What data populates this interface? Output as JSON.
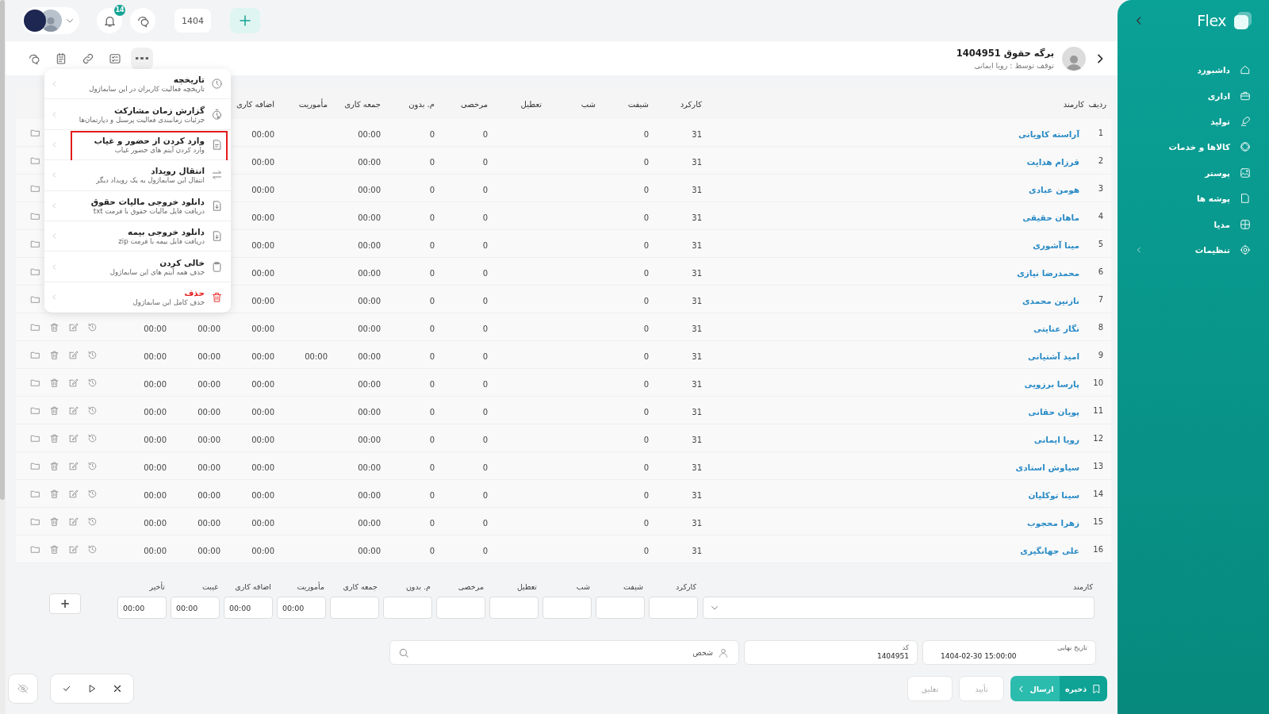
{
  "topbar": {
    "notification_count": "14",
    "year": "1404"
  },
  "header": {
    "title": "برگه حقوق 1404951",
    "subtitle": "توقف توسط : رویا ایمانی"
  },
  "toolbar": [
    {
      "kind": "chat",
      "selected": false
    },
    {
      "kind": "notes",
      "selected": false
    },
    {
      "kind": "link",
      "selected": false
    },
    {
      "kind": "checklist",
      "selected": false
    },
    {
      "kind": "more",
      "selected": true
    }
  ],
  "menu": {
    "items": [
      {
        "kind": "history",
        "title": "تاریخچه",
        "description": "تاریخچه فعالیت کاربران در این سابماژول",
        "highlighted": false
      },
      {
        "kind": "report",
        "title": "گزارش زمان مشارکت",
        "description": "جزئیات زمانبندی فعالیت پرسنل و دپارتمان‌ها",
        "highlighted": false
      },
      {
        "kind": "import",
        "title": "وارد کردن از حضور و غیاب",
        "description": "وارد کردن آیتم های حضور غیاب",
        "highlighted": true
      },
      {
        "kind": "transfer",
        "title": "انتقال رویداد",
        "description": "انتقال این سابماژول به یک رویداد دیگر",
        "highlighted": false
      },
      {
        "kind": "download",
        "title": "دانلود خروجی مالیات حقوق",
        "description": "دریافت فایل مالیات حقوق با فرمت txt",
        "highlighted": false
      },
      {
        "kind": "download",
        "title": "دانلود خروجی بیمه",
        "description": "دریافت فایل بیمه با فرمت zip",
        "highlighted": false
      },
      {
        "kind": "clear",
        "title": "خالی کردن",
        "description": "حذف همه آیتم های این سابماژول",
        "highlighted": false
      },
      {
        "kind": "delete",
        "title": "حذف",
        "description": "حذف کامل این سابماژول",
        "highlighted": false
      }
    ]
  },
  "table": {
    "columns": [
      "ردیف",
      "کارمند",
      "کارکرد",
      "شیفت",
      "شب",
      "تعطیل",
      "مرخصی",
      "م. بدون",
      "جمعه کاری",
      "مأموریت",
      "اضافه کاری"
    ],
    "rows": [
      {
        "number": "1",
        "name": "آراسته کاویانی",
        "worked": "31",
        "shift": "0",
        "leave": "0",
        "unpaid": "0",
        "friday": "00:00",
        "overtime": "00:00"
      },
      {
        "number": "2",
        "name": "فرزام هدایت",
        "worked": "31",
        "shift": "0",
        "leave": "0",
        "unpaid": "0",
        "friday": "00:00",
        "overtime": "00:00"
      },
      {
        "number": "3",
        "name": "هومن عبادی",
        "worked": "31",
        "shift": "0",
        "leave": "0",
        "unpaid": "0",
        "friday": "00:00",
        "overtime": "00:00"
      },
      {
        "number": "4",
        "name": "ماهان حقیقی",
        "worked": "31",
        "shift": "0",
        "leave": "0",
        "unpaid": "0",
        "friday": "00:00",
        "overtime": "00:00"
      },
      {
        "number": "5",
        "name": "مینا آشوری",
        "worked": "31",
        "shift": "0",
        "leave": "0",
        "unpaid": "0",
        "friday": "00:00",
        "overtime": "00:00"
      },
      {
        "number": "6",
        "name": "محمدرضا نیازی",
        "worked": "31",
        "shift": "0",
        "leave": "0",
        "unpaid": "0",
        "friday": "00:00",
        "overtime": "00:00"
      },
      {
        "number": "7",
        "name": "نازنین محمدی",
        "worked": "31",
        "shift": "0",
        "leave": "0",
        "unpaid": "0",
        "friday": "00:00",
        "overtime": "00:00"
      },
      {
        "number": "8",
        "name": "نگار عنایتی",
        "worked": "31",
        "shift": "0",
        "leave": "0",
        "unpaid": "0",
        "friday": "00:00",
        "overtime": "00:00",
        "absence": "00:00",
        "late": "00:00"
      },
      {
        "number": "9",
        "name": "امید آشتیانی",
        "worked": "31",
        "shift": "0",
        "leave": "0",
        "unpaid": "0",
        "friday": "00:00",
        "mission": "00:00",
        "overtime": "00:00",
        "absence": "00:00",
        "late": "00:00"
      },
      {
        "number": "10",
        "name": "پارسا برزویی",
        "worked": "31",
        "shift": "0",
        "leave": "0",
        "unpaid": "0",
        "friday": "00:00",
        "overtime": "00:00",
        "absence": "00:00",
        "late": "00:00"
      },
      {
        "number": "11",
        "name": "پویان حقانی",
        "worked": "31",
        "shift": "0",
        "leave": "0",
        "unpaid": "0",
        "friday": "00:00",
        "overtime": "00:00",
        "absence": "00:00",
        "late": "00:00"
      },
      {
        "number": "12",
        "name": "رویا ایمانی",
        "worked": "31",
        "shift": "0",
        "leave": "0",
        "unpaid": "0",
        "friday": "00:00",
        "overtime": "00:00",
        "absence": "00:00",
        "late": "00:00"
      },
      {
        "number": "13",
        "name": "سیاوش استادی",
        "worked": "31",
        "shift": "0",
        "leave": "0",
        "unpaid": "0",
        "friday": "00:00",
        "overtime": "00:00",
        "absence": "00:00",
        "late": "00:00"
      },
      {
        "number": "14",
        "name": "سینا توکلیان",
        "worked": "31",
        "shift": "0",
        "leave": "0",
        "unpaid": "0",
        "friday": "00:00",
        "overtime": "00:00",
        "absence": "00:00",
        "late": "00:00"
      },
      {
        "number": "15",
        "name": "زهرا محجوب",
        "worked": "31",
        "shift": "0",
        "leave": "0",
        "unpaid": "0",
        "friday": "00:00",
        "overtime": "00:00",
        "absence": "00:00",
        "late": "00:00"
      },
      {
        "number": "16",
        "name": "علی جهانگیری",
        "worked": "31",
        "shift": "0",
        "leave": "0",
        "unpaid": "0",
        "friday": "00:00",
        "overtime": "00:00",
        "absence": "00:00",
        "late": "00:00"
      }
    ]
  },
  "entry_form": {
    "employee_label": "کارمند",
    "fields": [
      {
        "label": "کارکرد"
      },
      {
        "label": "شیفت"
      },
      {
        "label": "شب"
      },
      {
        "label": "تعطیل"
      },
      {
        "label": "مرخصی"
      },
      {
        "label": "م. بدون"
      },
      {
        "label": "جمعه کاری"
      },
      {
        "label": "مأموریت",
        "value": "00:00"
      },
      {
        "label": "اضافه کاری",
        "value": "00:00"
      },
      {
        "label": "غیبت",
        "value": "00:00"
      },
      {
        "label": "تأخیر",
        "value": "00:00"
      }
    ],
    "add_button": "+"
  },
  "details": {
    "fields": [
      {
        "kind": "date",
        "label": "تاریخ نهایی",
        "value": "1404-02-30 15:00:00"
      },
      {
        "kind": "code",
        "label": "کد",
        "value": "1404951"
      }
    ],
    "person": {
      "placeholder": "شخص"
    }
  },
  "footer": {
    "buttons": [
      {
        "kind": "save",
        "label": "ذخیره",
        "disabled": false
      },
      {
        "kind": "send",
        "label": "ارسال",
        "disabled": false
      },
      {
        "kind": "plain",
        "label": "تأیید",
        "disabled": true
      },
      {
        "kind": "plain",
        "label": "تعلیق",
        "disabled": true
      }
    ]
  },
  "sidebar": {
    "logo": "Flex",
    "items": [
      {
        "kind": "home",
        "label": "داشبورد",
        "expandable": false
      },
      {
        "kind": "briefcase",
        "label": "اداری",
        "expandable": false
      },
      {
        "kind": "production",
        "label": "تولید",
        "expandable": false
      },
      {
        "kind": "goods",
        "label": "کالاها و خدمات",
        "expandable": false
      },
      {
        "kind": "image",
        "label": "پوستر",
        "expandable": false
      },
      {
        "kind": "folder",
        "label": "پوشه ها",
        "expandable": false
      },
      {
        "kind": "media",
        "label": "مدیا",
        "expandable": false
      },
      {
        "kind": "settings",
        "label": "تنظیمات",
        "expandable": true
      }
    ]
  }
}
